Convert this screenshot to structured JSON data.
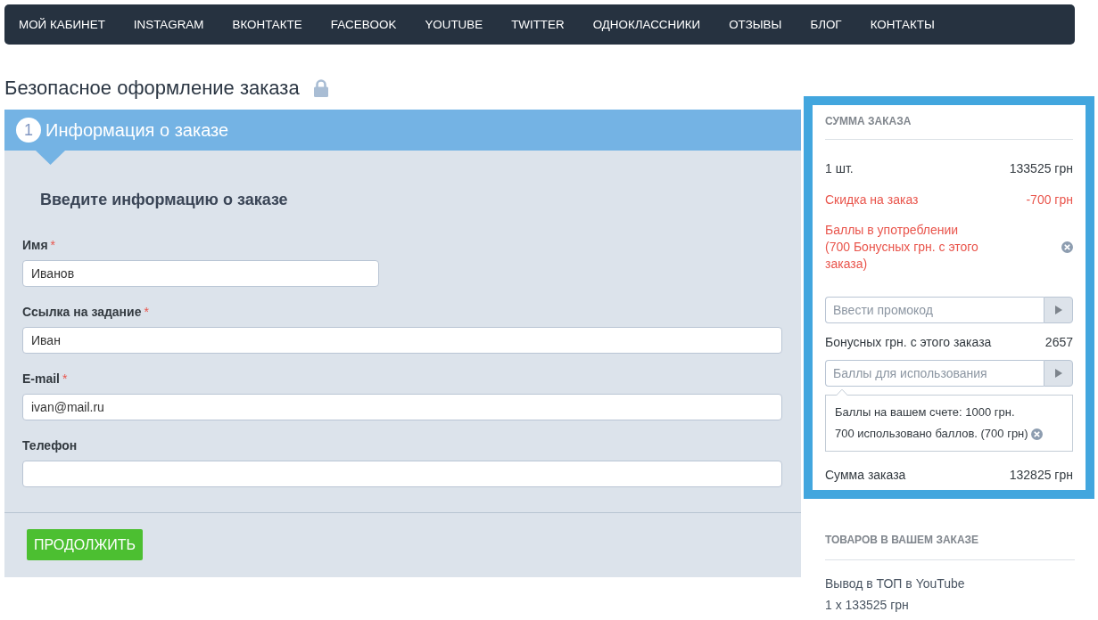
{
  "nav": {
    "items": [
      "МОЙ КАБИНЕТ",
      "INSTAGRAM",
      "ВКОНТАКТЕ",
      "FACEBOOK",
      "YOUTUBE",
      "TWITTER",
      "ОДНОКЛАССНИКИ",
      "ОТЗЫВЫ",
      "БЛОГ",
      "КОНТАКТЫ"
    ]
  },
  "page_title": "Безопасное оформление заказа",
  "checkout_step": {
    "number": "1",
    "title": "Информация о заказе",
    "heading": "Введите информацию о заказе",
    "fields": [
      {
        "kind": "short",
        "label": "Имя",
        "asterisk": "*",
        "value": "Иванов"
      },
      {
        "kind": "wide",
        "label": "Ссылка на задание",
        "asterisk": "*",
        "value": "Иван"
      },
      {
        "kind": "wide",
        "label": "E-mail",
        "asterisk": "*",
        "value": "ivan@mail.ru"
      },
      {
        "kind": "wide",
        "label": "Телефон"
      }
    ],
    "button": "ПРОДОЛЖИТЬ"
  },
  "order_summary": {
    "title": "СУММА ЗАКАЗА",
    "lines": [
      {
        "kind": "plain",
        "label": "1 шт.",
        "value": "133525 грн",
        "removable": false
      },
      {
        "kind": "discount",
        "label": "Скидка на заказ",
        "value": "-700 грн",
        "removable": false
      },
      {
        "kind": "applied",
        "label": "Баллы в употреблении (700 Бонусных грн. с этого заказа)",
        "removable": true
      }
    ],
    "promo_field": {
      "placeholder": "Ввести промокод"
    },
    "bonus": {
      "label": "Бонусных грн. с этого заказа",
      "value": "2657"
    },
    "points_field": {
      "placeholder": "Баллы для использования"
    },
    "points_popover": {
      "lines": [
        {
          "text": "Баллы на вашем счете: 1000 грн.",
          "removable": false
        },
        {
          "text": "700 использовано баллов. (700 грн)",
          "removable": true
        }
      ]
    },
    "total": {
      "label": "Сумма заказа",
      "value": "132825 грн"
    }
  },
  "cart": {
    "title": "ТОВАРОВ В ВАШЕМ ЗАКАЗЕ",
    "items": [
      {
        "name": "Вывод в ТОП в YouTube",
        "price": "1 x 133525 грн"
      }
    ]
  }
}
